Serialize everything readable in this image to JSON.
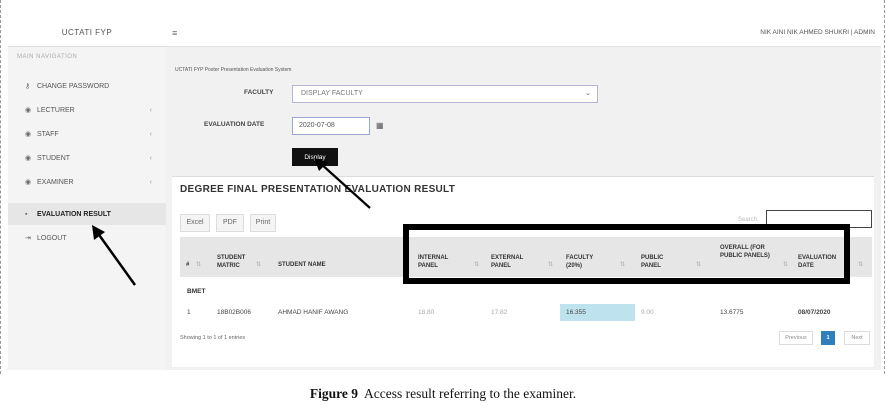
{
  "app": {
    "brand": "UCTATI FYP",
    "user": "NIK AINI NIK AHMED SHUKRI | ADMIN",
    "breadcrumb": "UCTATI FYP Poster Presentation Evaluation System"
  },
  "sidebar": {
    "header": "MAIN NAVIGATION",
    "items": [
      {
        "label": "CHANGE PASSWORD",
        "icon": "key-icon",
        "glyph": "⚷",
        "has_sub": false
      },
      {
        "label": "LECTURER",
        "icon": "users-icon",
        "glyph": "◉",
        "has_sub": true
      },
      {
        "label": "STAFF",
        "icon": "users-icon",
        "glyph": "◉",
        "has_sub": true
      },
      {
        "label": "STUDENT",
        "icon": "users-icon",
        "glyph": "◉",
        "has_sub": true
      },
      {
        "label": "EXAMINER",
        "icon": "users-icon",
        "glyph": "◉",
        "has_sub": true
      },
      {
        "label": "EVALUATION RESULT",
        "icon": "file-icon",
        "glyph": "▪",
        "has_sub": false,
        "active": true
      },
      {
        "label": "LOGOUT",
        "icon": "logout-icon",
        "glyph": "⇥",
        "has_sub": false
      }
    ],
    "chevron": "‹"
  },
  "form": {
    "faculty_label": "FACULTY",
    "faculty_value": "DISPLAY FACULTY",
    "date_label": "EVALUATION DATE",
    "date_value": "2020-07-08",
    "display_label": "Display"
  },
  "result": {
    "title": "DEGREE FINAL PRESENTATION EVALUATION RESULT",
    "export_buttons": [
      "Excel",
      "PDF",
      "Print"
    ],
    "search_label": "Search:",
    "columns": [
      "#",
      "STUDENT MATRIC",
      "STUDENT NAME",
      "INTERNAL PANEL",
      "EXTERNAL PANEL",
      "FACULTY (20%)",
      "PUBLIC PANEL",
      "OVERALL (FOR PUBLIC PANELS)",
      "EVALUATION DATE"
    ],
    "group": "BMET",
    "rows": [
      {
        "no": "1",
        "matric": "18B02B006",
        "name": "AHMAD HANIF AWANG",
        "internal": "18.80",
        "external": "17.82",
        "faculty": "16.355",
        "public": "9.00",
        "overall": "13.6775",
        "date": "08/07/2020"
      }
    ],
    "showing": "Showing 1 to 1 of 1 entries",
    "pager": {
      "previous": "Previous",
      "current": "1",
      "next": "Next"
    }
  },
  "caption": {
    "figure": "Figure 9",
    "text": "Access result referring to the examiner."
  },
  "colors": {
    "faculty_highlight": "#bfe3ee",
    "page_active": "#2f7fbf",
    "display_button": "#111111"
  }
}
